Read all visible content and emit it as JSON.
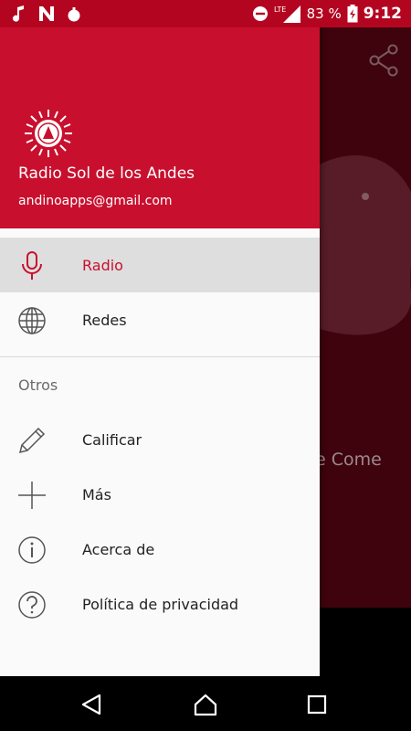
{
  "status_bar": {
    "battery_percent": "83 %",
    "time": "9:12",
    "network": "LTE",
    "icons": [
      "music-note-icon",
      "n-app-icon",
      "bomb-icon",
      "do-not-disturb-icon",
      "signal-icon",
      "battery-icon"
    ]
  },
  "drawer": {
    "header": {
      "station_name": "Radio Sol de los Andes",
      "email": "andinoapps@gmail.com",
      "logo": "sun-logo-icon"
    },
    "items": [
      {
        "label": "Radio",
        "icon": "microphone-icon",
        "active": true
      },
      {
        "label": "Redes",
        "icon": "globe-icon",
        "active": false
      }
    ],
    "section_title": "Otros",
    "other_items": [
      {
        "label": "Calificar",
        "icon": "pencil-icon"
      },
      {
        "label": "Más",
        "icon": "plus-icon"
      },
      {
        "label": "Acerca de",
        "icon": "info-icon"
      },
      {
        "label": "Política de privacidad",
        "icon": "help-icon"
      }
    ]
  },
  "background": {
    "partial_text": "e Come",
    "share_icon": "share-icon"
  },
  "nav_bar": {
    "buttons": [
      "back-icon",
      "home-icon",
      "recents-icon"
    ]
  },
  "colors": {
    "brand_red": "#c8102e",
    "status_bar": "#b40520",
    "background_dark_red": "#4a0410",
    "active_item_bg": "#dedede"
  }
}
